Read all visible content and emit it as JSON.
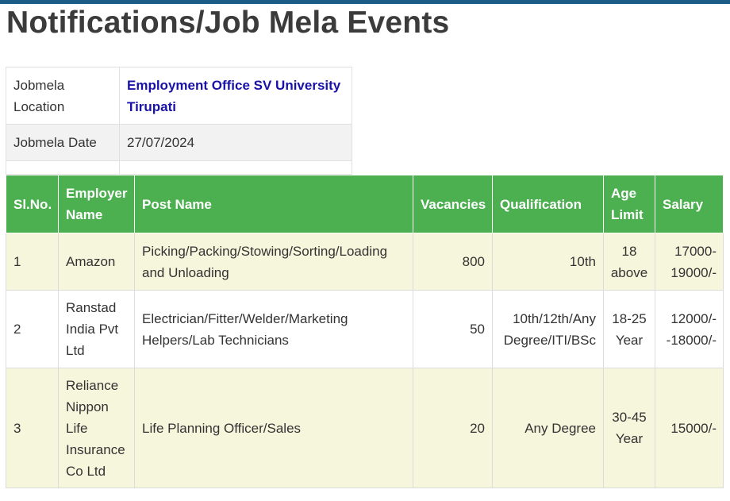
{
  "page": {
    "title": "Notifications/Job Mela Events"
  },
  "info": {
    "location_label": "Jobmela Location",
    "location_value": "Employment Office SV University Tirupati",
    "date_label": "Jobmela Date",
    "date_value": "27/07/2024"
  },
  "jobs": {
    "headers": {
      "slno": "Sl.No.",
      "employer": "Employer Name",
      "post": "Post Name",
      "vacancies": "Vacancies",
      "qualification": "Qualification",
      "age": "Age Limit",
      "salary": "Salary"
    },
    "rows": [
      {
        "slno": "1",
        "employer": "Amazon",
        "post": "Picking/Packing/Stowing/Sorting/Loading and Unloading",
        "vacancies": "800",
        "qualification": "10th",
        "age": "18 above",
        "salary": "17000-19000/-"
      },
      {
        "slno": "2",
        "employer": "Ranstad India Pvt Ltd",
        "post": "Electrician/Fitter/Welder/Marketing Helpers/Lab Technicians",
        "vacancies": "50",
        "qualification": "10th/12th/Any Degree/ITI/BSc",
        "age": "18-25 Year",
        "salary": "12000/--18000/-"
      },
      {
        "slno": "3",
        "employer": "Reliance Nippon Life Insurance Co Ltd",
        "post": "Life Planning Officer/Sales",
        "vacancies": "20",
        "qualification": "Any Degree",
        "age": "30-45 Year",
        "salary": "15000/-"
      }
    ]
  },
  "colors": {
    "header_green": "#4caf50",
    "link_blue": "#1a12a8",
    "topbar": "#1c5d87",
    "row_tint": "#f6f6dc"
  }
}
